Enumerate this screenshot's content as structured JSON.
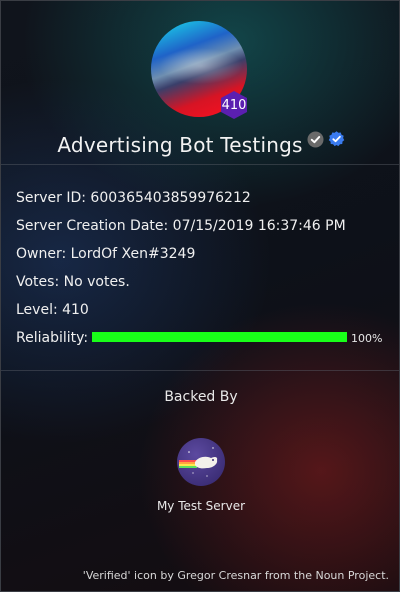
{
  "server": {
    "name": "Advertising Bot Testings",
    "level_badge": "410",
    "id_line": "Server ID: 600365403859976212",
    "creation_line": "Server Creation Date: 07/15/2019 16:37:46 PM",
    "owner_line": "Owner: LordOf Xen#3249",
    "votes_line": "Votes: No votes.",
    "level_line": "Level: 410",
    "reliability_label": "Reliability:",
    "reliability_value": 1.0,
    "reliability_pct": "100%"
  },
  "badges": {
    "partner_icon": "checkmark-gray-icon",
    "verified_icon": "verified-check-icon"
  },
  "backed_by": {
    "title": "Backed By",
    "servers": [
      {
        "name": "My Test Server",
        "icon": "flying-creature-icon"
      }
    ]
  },
  "footer": {
    "credit": "'Verified' icon by Gregor Cresnar from the Noun Project."
  },
  "colors": {
    "accent_badge": "#5b1fb0",
    "reliability_bar": "#19ff19",
    "verified_blue": "#3a7bef"
  }
}
